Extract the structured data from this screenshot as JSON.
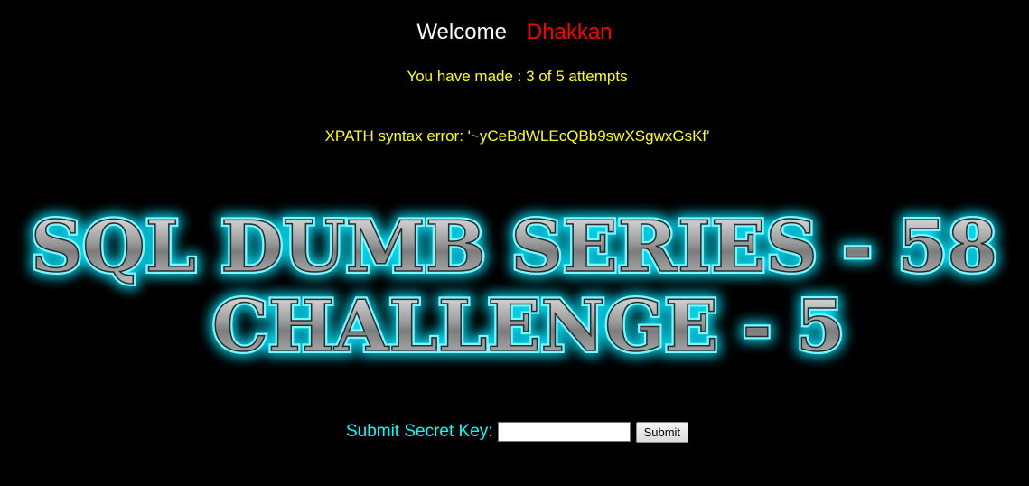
{
  "header": {
    "welcome": "Welcome",
    "username": "Dhakkan"
  },
  "status": {
    "attempts": "You have made : 3 of 5 attempts",
    "error": "XPATH syntax error: '~yCeBdWLEcQBb9swXSgwxGsKf'"
  },
  "banner": {
    "line1": "SQL DUMB SERIES - 58",
    "line2": "CHALLENGE - 5"
  },
  "form": {
    "label": "Submit Secret Key:",
    "input_value": "",
    "submit_label": "Submit"
  },
  "colors": {
    "background": "#000000",
    "welcome": "#ffffff",
    "username": "#ff0000",
    "status_text": "#ffff00",
    "form_label": "#00ffff",
    "banner_glow": "#00e5ff"
  }
}
